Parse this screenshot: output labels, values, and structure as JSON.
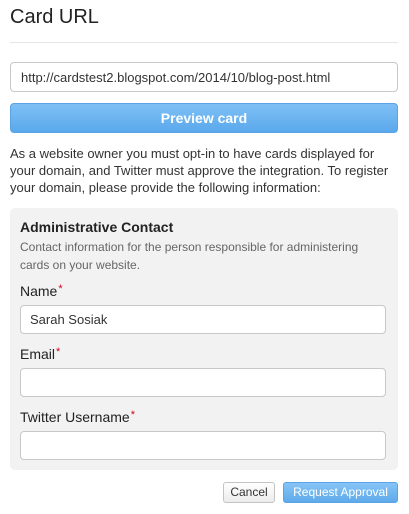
{
  "header": {
    "title": "Card URL"
  },
  "url_field": {
    "value": "http://cardstest2.blogspot.com/2014/10/blog-post.html"
  },
  "preview_button": {
    "label": "Preview card"
  },
  "info_text": "As a website owner you must opt-in to have cards displayed for your domain, and Twitter must approve the integration. To register your domain, please provide the following information:",
  "contact_panel": {
    "title": "Administrative Contact",
    "description": "Contact information for the person responsible for administering cards on your website.",
    "required_marker": "*",
    "fields": [
      {
        "label": "Name",
        "value": "Sarah Sosiak"
      },
      {
        "label": "Email",
        "value": ""
      },
      {
        "label": "Twitter Username",
        "value": ""
      }
    ]
  },
  "actions": {
    "cancel_label": "Cancel",
    "submit_label": "Request Approval"
  },
  "colors": {
    "accent": "#5aa8ec",
    "required": "#d0021b",
    "panel_bg": "#f2f2f2"
  }
}
